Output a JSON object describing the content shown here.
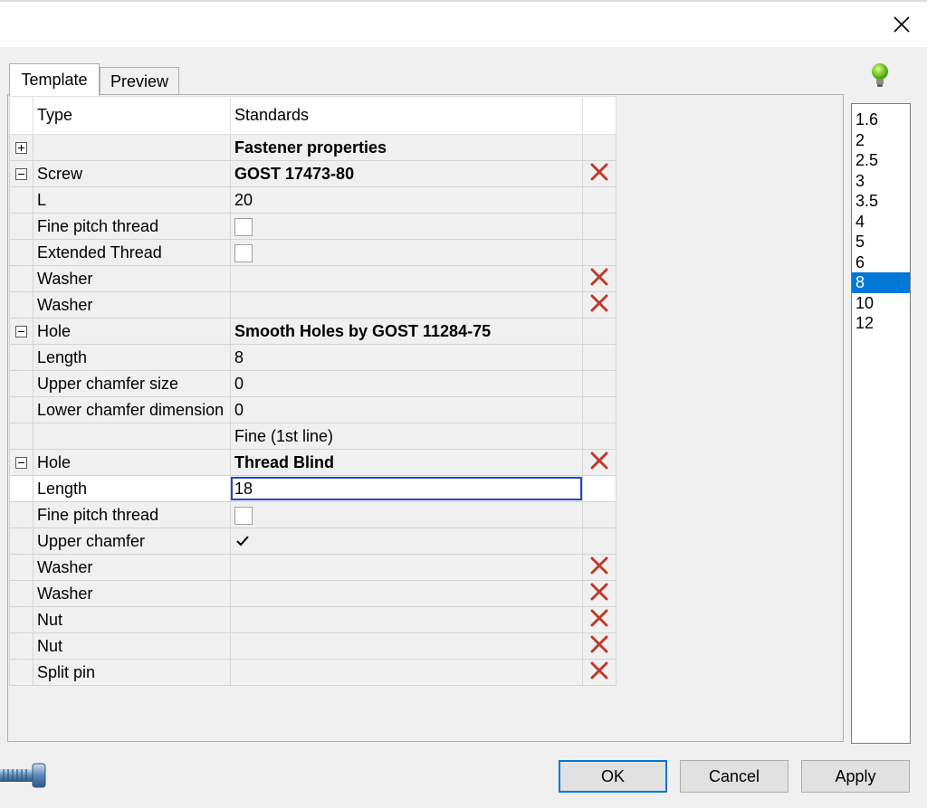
{
  "tabs": {
    "template": "Template",
    "preview": "Preview"
  },
  "grid": {
    "header": {
      "type": "Type",
      "standards": "Standards"
    },
    "rows": [
      {
        "expander": "plus",
        "type": "",
        "standard": "Fastener properties",
        "bold": true,
        "delete": false
      },
      {
        "expander": "minus",
        "type": "Screw",
        "standard": "GOST 17473-80",
        "bold": true,
        "delete": true
      },
      {
        "expander": "",
        "type": "L",
        "standard": "20",
        "bold": false,
        "delete": false
      },
      {
        "expander": "",
        "type": "Fine pitch thread",
        "checkbox": false,
        "delete": false
      },
      {
        "expander": "",
        "type": "Extended Thread",
        "checkbox": false,
        "delete": false
      },
      {
        "expander": "",
        "type": "Washer",
        "standard": "",
        "delete": true
      },
      {
        "expander": "",
        "type": "Washer",
        "standard": "",
        "delete": true
      },
      {
        "expander": "minus",
        "type": "Hole",
        "standard": "Smooth Holes by GOST 11284-75",
        "bold": true,
        "delete": false
      },
      {
        "expander": "",
        "type": "Length",
        "standard": "8",
        "delete": false
      },
      {
        "expander": "",
        "type": "Upper chamfer size",
        "standard": "0",
        "delete": false
      },
      {
        "expander": "",
        "type": "Lower chamfer dimension",
        "standard": "0",
        "delete": false
      },
      {
        "expander": "",
        "type": "",
        "standard": "Fine (1st line)",
        "delete": false
      },
      {
        "expander": "minus",
        "type": "Hole",
        "standard": "Thread Blind",
        "bold": true,
        "delete": true
      },
      {
        "expander": "",
        "type": "Length",
        "standard": "18",
        "editing": true,
        "delete": false
      },
      {
        "expander": "",
        "type": "Fine pitch thread",
        "checkbox": false,
        "delete": false
      },
      {
        "expander": "",
        "type": "Upper chamfer",
        "checkbox": true,
        "delete": false
      },
      {
        "expander": "",
        "type": "Washer",
        "standard": "",
        "delete": true
      },
      {
        "expander": "",
        "type": "Washer",
        "standard": "",
        "delete": true
      },
      {
        "expander": "",
        "type": "Nut",
        "standard": "",
        "delete": true
      },
      {
        "expander": "",
        "type": "Nut",
        "standard": "",
        "delete": true
      },
      {
        "expander": "",
        "type": "Split pin",
        "standard": "",
        "delete": true
      }
    ]
  },
  "sizes": {
    "options": [
      "1.6",
      "2",
      "2.5",
      "3",
      "3.5",
      "4",
      "5",
      "6",
      "8",
      "10",
      "12"
    ],
    "selected": "8"
  },
  "buttons": {
    "ok": "OK",
    "cancel": "Cancel",
    "apply": "Apply"
  },
  "colors": {
    "accent": "#0078d7",
    "delete": "#c0392b",
    "edit_border": "#2946c4"
  }
}
